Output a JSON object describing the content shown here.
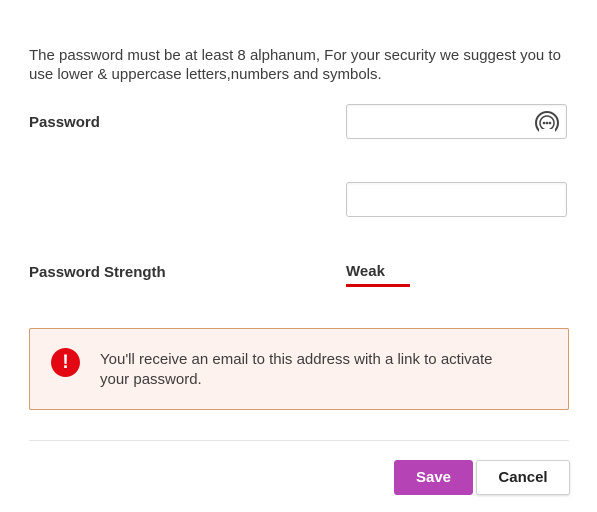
{
  "intro_text": "The password must be at least 8 alphanum, For your security we suggest you to use lower & uppercase letters,numbers and symbols.",
  "password_field": {
    "label": "Password",
    "value": "",
    "reveal_icon": "password-manager-icon"
  },
  "confirm_field": {
    "value": ""
  },
  "strength": {
    "label": "Password Strength",
    "value": "Weak",
    "bar_color": "#d50000"
  },
  "alert": {
    "icon": "error-icon",
    "icon_glyph": "!",
    "message": "You'll receive an email to this address with a link to activate your password.",
    "accent_color": "#e30613"
  },
  "actions": {
    "save_label": "Save",
    "cancel_label": "Cancel",
    "save_color": "#b643b5"
  }
}
